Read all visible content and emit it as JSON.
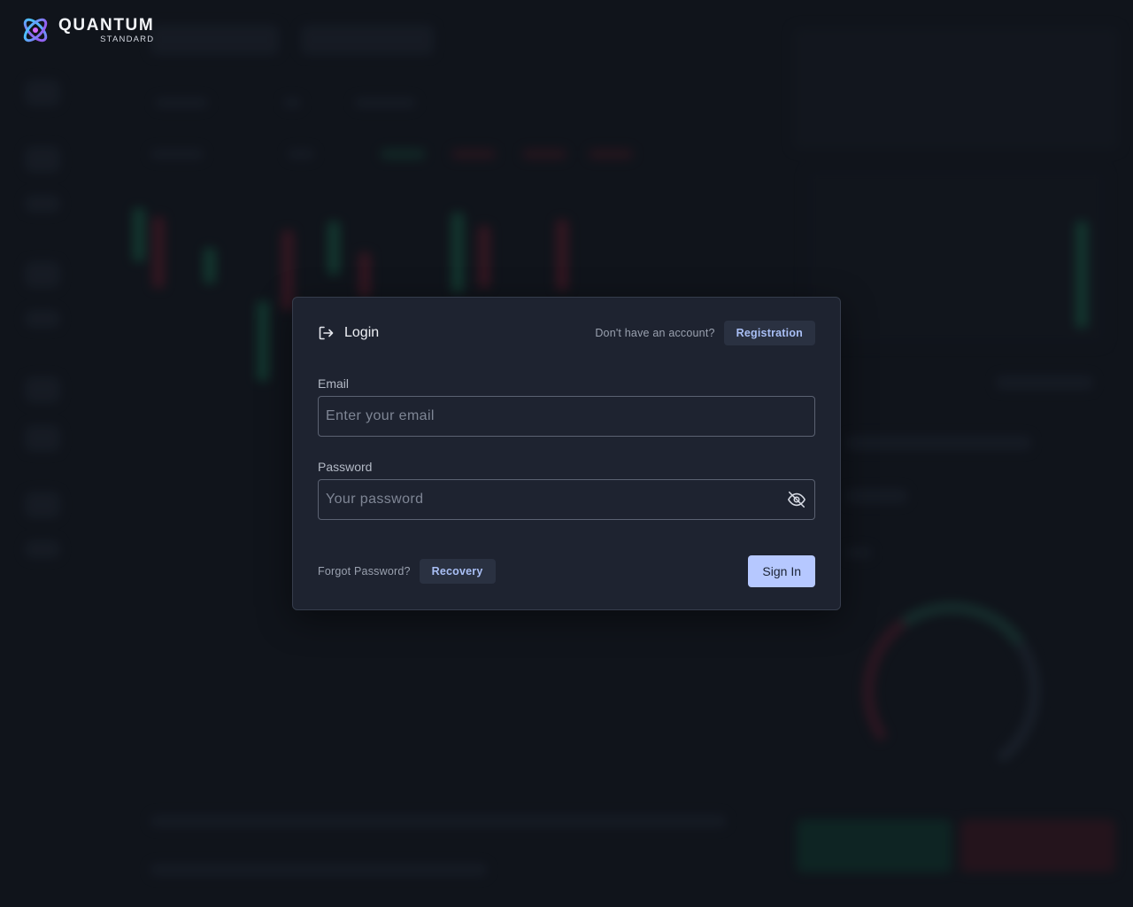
{
  "brand": {
    "name": "QUANTUM",
    "subname": "STANDARD",
    "icon": "quantum-logo-icon"
  },
  "login": {
    "title": "Login",
    "title_icon": "login-arrow-icon",
    "no_account_text": "Don't have an account?",
    "registration_label": "Registration",
    "email": {
      "label": "Email",
      "placeholder": "Enter your email",
      "value": ""
    },
    "password": {
      "label": "Password",
      "placeholder": "Your password",
      "value": "",
      "toggle_icon": "eye-off-icon"
    },
    "forgot_text": "Forgot Password?",
    "recovery_label": "Recovery",
    "submit_label": "Sign In"
  },
  "colors": {
    "background": "#141821",
    "dialog": "#1e2330",
    "accent": "#b6c8ff",
    "link": "#a9bff5"
  }
}
